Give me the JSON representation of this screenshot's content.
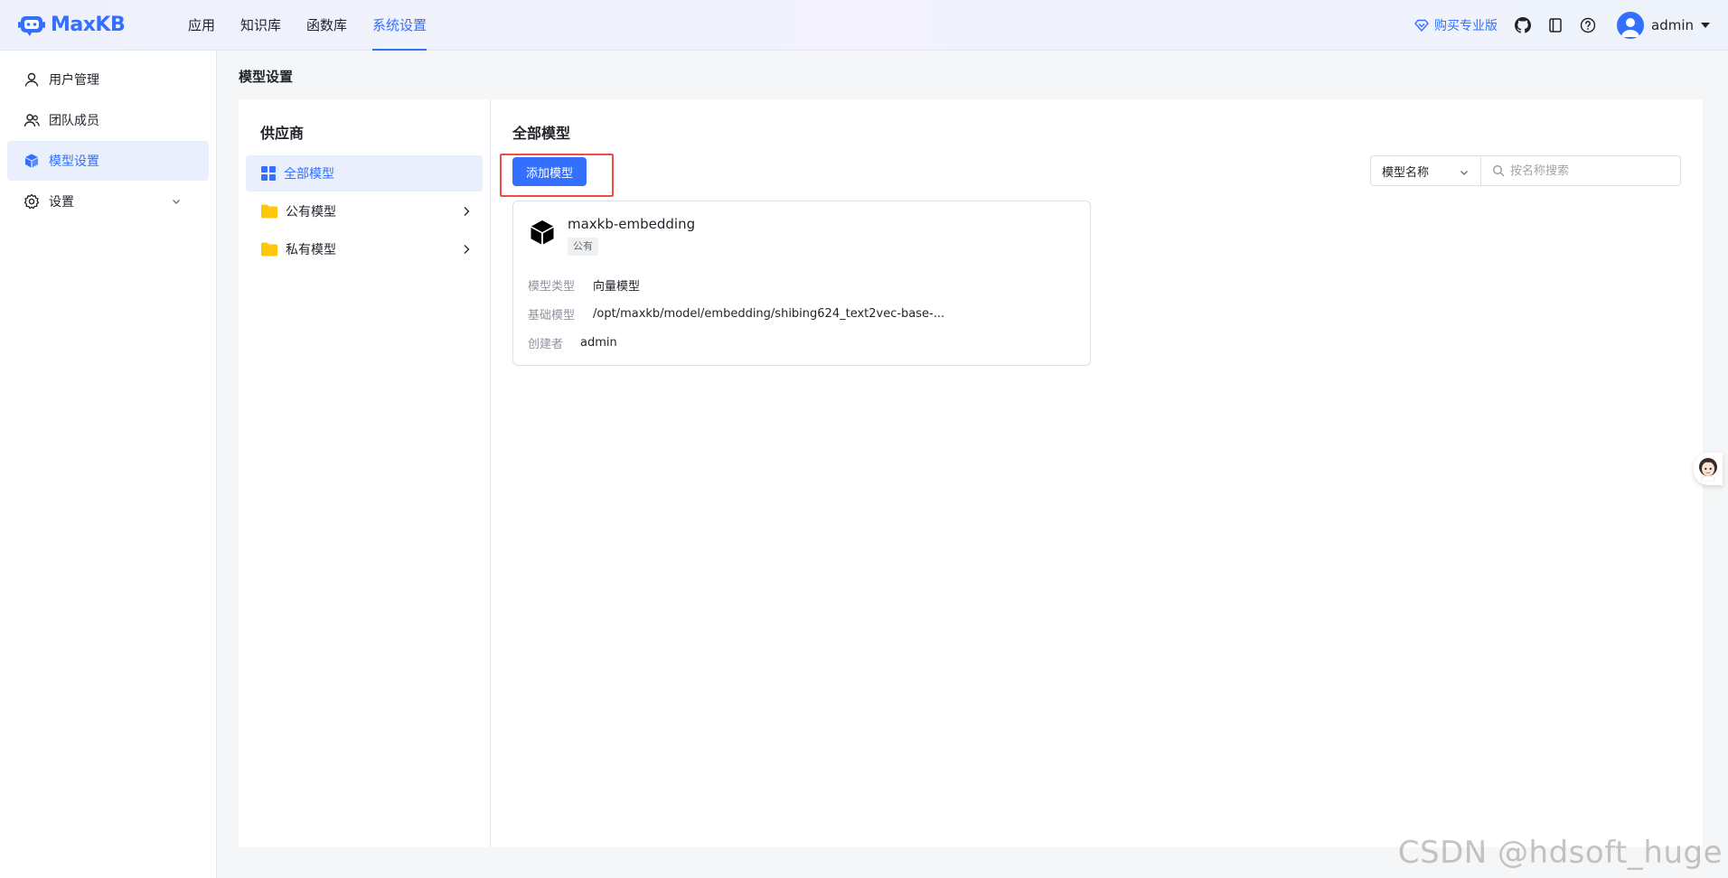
{
  "app": {
    "name": "MaxKB"
  },
  "nav": {
    "items": [
      {
        "label": "应用"
      },
      {
        "label": "知识库"
      },
      {
        "label": "函数库"
      },
      {
        "label": "系统设置"
      }
    ],
    "active": "系统设置"
  },
  "header": {
    "buy_pro": "购买专业版",
    "user": "admin"
  },
  "sidebar": {
    "items": [
      {
        "label": "用户管理",
        "icon": "user-icon"
      },
      {
        "label": "团队成员",
        "icon": "team-icon"
      },
      {
        "label": "模型设置",
        "icon": "cube-icon",
        "active": true
      },
      {
        "label": "设置",
        "icon": "gear-icon"
      }
    ]
  },
  "page": {
    "title": "模型设置"
  },
  "providers": {
    "title": "供应商",
    "items": [
      {
        "label": "全部模型",
        "icon": "grid-icon",
        "active": true
      },
      {
        "label": "公有模型",
        "icon": "folder-icon"
      },
      {
        "label": "私有模型",
        "icon": "folder-icon"
      }
    ]
  },
  "models": {
    "title": "全部模型",
    "add_button": "添加模型",
    "filter_select": "模型名称",
    "search_placeholder": "按名称搜索",
    "cards": [
      {
        "name": "maxkb-embedding",
        "tag": "公有",
        "rows": [
          {
            "key": "模型类型",
            "value": "向量模型"
          },
          {
            "key": "基础模型",
            "value": "/opt/maxkb/model/embedding/shibing624_text2vec-base-..."
          },
          {
            "key": "创建者",
            "value": "admin"
          }
        ]
      }
    ]
  },
  "watermark": "CSDN @hdsoft_huge",
  "colors": {
    "accent": "#3370ff",
    "highlight": "#f54a45"
  }
}
